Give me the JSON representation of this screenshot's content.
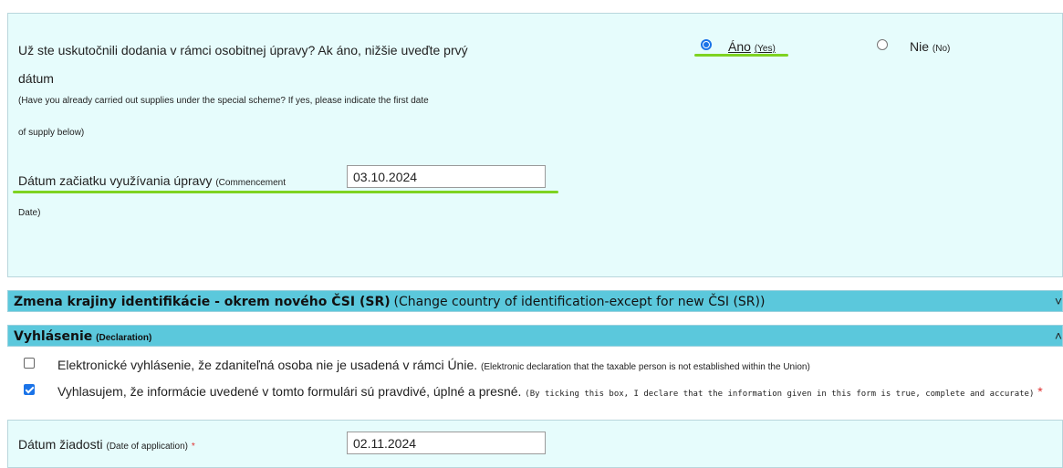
{
  "question": {
    "line1": "Už ste uskutočnili dodania v rámci osobitnej úpravy? Ak áno, nižšie uveďte prvý",
    "line2": "dátum",
    "en_line1": "(Have you already carried out supplies under the special scheme? If yes, please indicate the first date",
    "en_line2": "of supply below)",
    "yes_label": "Áno",
    "yes_en": "(Yes)",
    "no_label": "Nie",
    "no_en": "(No)",
    "selected": "yes"
  },
  "commencement": {
    "label": "Dátum začiatku využívania úpravy",
    "label_en1": "(Commencement",
    "label_en2": "Date)",
    "value": "03.10.2024"
  },
  "sections": {
    "change_country": {
      "title": "Zmena krajiny identifikácie - okrem nového ČSI (SR)",
      "title_en": "(Change country of identification-except for new ČSI (SR))",
      "chevron": "˅"
    },
    "declaration": {
      "title": "Vyhlásenie",
      "title_en": "(Declaration)",
      "chevron": "˄"
    }
  },
  "declarations": [
    {
      "text": "Elektronické vyhlásenie, že zdaniteľná osoba nie je usadená v rámci Únie.",
      "text_en": "(Elektronic declaration that the taxable person is not established within the Union)",
      "checked": false
    },
    {
      "text": "Vyhlasujem, že informácie uvedené v tomto formulári sú pravdivé, úplné a presné.",
      "text_en": "(By ticking this box, I declare that the information given in this form is true, complete and accurate)",
      "required_mark": "*",
      "checked": true
    }
  ],
  "application": {
    "label": "Dátum žiadosti",
    "label_en": "(Date of application)",
    "required_mark": "*",
    "value": "02.11.2024"
  },
  "colors": {
    "panel_bg": "#e6fcfc",
    "section_bar": "#5bc8dc",
    "highlight": "#7ed321",
    "accent": "#1a73e8",
    "required": "#e03030"
  }
}
